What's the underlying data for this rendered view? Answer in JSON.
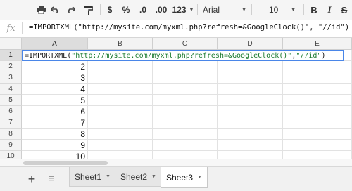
{
  "toolbar": {
    "currency_label": "$",
    "percent_label": "%",
    "decrease_decimals_label": ".0",
    "increase_decimals_label": ".00",
    "number_format_label": "123",
    "font_name": "Arial",
    "font_size": "10",
    "bold_label": "B",
    "italic_label": "I",
    "strikethrough_label": "S"
  },
  "formula_bar": {
    "fx_label": "fx",
    "value": "=IMPORTXML(\"http://mysite.com/myxml.php?refresh=&GoogleClock()\", \"//id\")"
  },
  "grid": {
    "columns": [
      "A",
      "B",
      "C",
      "D",
      "E"
    ],
    "rows": [
      "1",
      "2",
      "3",
      "4",
      "5",
      "6",
      "7",
      "8",
      "9",
      "10"
    ],
    "column_a_values": [
      "",
      "2",
      "3",
      "4",
      "5",
      "6",
      "7",
      "8",
      "9",
      "10"
    ],
    "active_cell": {
      "prefix": "=IMPORTXML(",
      "url": "\"http://mysite.com/myxml.php?refresh=&GoogleClock()\"",
      "sep": ", ",
      "xpath": "\"//id\"",
      "suffix": ")"
    }
  },
  "sheets": {
    "add_label": "+",
    "list_label": "≡",
    "tabs": [
      "Sheet1",
      "Sheet2",
      "Sheet3"
    ],
    "active_index": 2
  },
  "colors": {
    "selection_border": "#4a86e8",
    "string_color": "#1a7a2e"
  }
}
